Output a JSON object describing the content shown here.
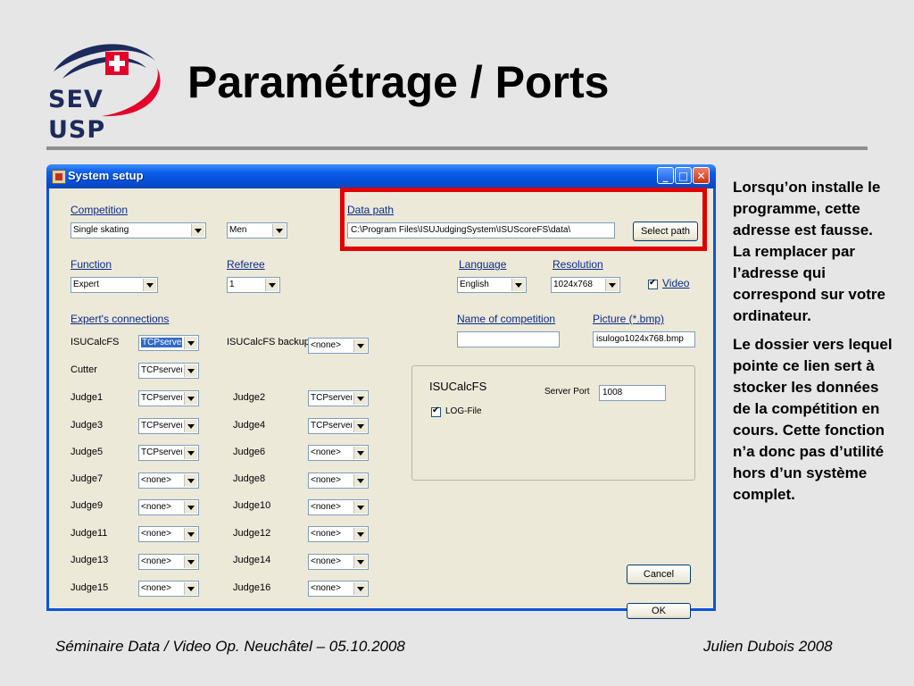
{
  "slide": {
    "logo_top": "SEV",
    "logo_bottom": "USP",
    "title": "Paramétrage / Ports",
    "side_text": [
      "Lorsqu’on installe le programme, cette adresse est fausse. La remplacer par l’adresse qui correspond sur votre ordinateur.",
      "Le dossier vers lequel pointe ce lien sert à stocker les données de la compétition en cours. Cette fonction n’a donc pas d’utilité hors d’un système complet."
    ],
    "footer_left": "Séminaire Data / Video Op. Neuchâtel – 05.10.2008",
    "footer_right": "Julien Dubois 2008",
    "colors": {
      "highlight": "#e00000",
      "logo_red": "#e4002b",
      "logo_blue": "#1d2a5c"
    }
  },
  "window": {
    "title": "System setup",
    "controls": {
      "minimize": "_",
      "maximize": "□",
      "close": "✕"
    }
  },
  "setup": {
    "competition_label": "Competition",
    "competition_value": "Single skating",
    "gender_value": "Men",
    "data_path_label": "Data path",
    "data_path_value": "C:\\Program Files\\ISUJudgingSystem\\ISUScoreFS\\data\\",
    "select_path_button": "Select path",
    "function_label": "Function",
    "function_value": "Expert",
    "referee_label": "Referee",
    "referee_value": "1",
    "language_label": "Language",
    "language_value": "English",
    "resolution_label": "Resolution",
    "resolution_value": "1024x768",
    "video_label": "Video",
    "expert_connections_label": "Expert's connections",
    "name_of_competition_label": "Name of competition",
    "name_of_competition_value": "",
    "picture_label": "Picture (*.bmp)",
    "picture_value": "isulogo1024x768.bmp",
    "connections": {
      "isucalcfs": {
        "label": "ISUCalcFS",
        "value": "TCPserver"
      },
      "isucalcfs_backup": {
        "label": "ISUCalcFS backup",
        "value": "<none>"
      },
      "cutter": {
        "label": "Cutter",
        "value": "TCPserver"
      },
      "judge1": {
        "label": "Judge1",
        "value": "TCPserver"
      },
      "judge2": {
        "label": "Judge2",
        "value": "TCPserver"
      },
      "judge3": {
        "label": "Judge3",
        "value": "TCPserver"
      },
      "judge4": {
        "label": "Judge4",
        "value": "TCPserver"
      },
      "judge5": {
        "label": "Judge5",
        "value": "TCPserver"
      },
      "judge6": {
        "label": "Judge6",
        "value": "<none>"
      },
      "judge7": {
        "label": "Judge7",
        "value": "<none>"
      },
      "judge8": {
        "label": "Judge8",
        "value": "<none>"
      },
      "judge9": {
        "label": "Judge9",
        "value": "<none>"
      },
      "judge10": {
        "label": "Judge10",
        "value": "<none>"
      },
      "judge11": {
        "label": "Judge11",
        "value": "<none>"
      },
      "judge12": {
        "label": "Judge12",
        "value": "<none>"
      },
      "judge13": {
        "label": "Judge13",
        "value": "<none>"
      },
      "judge14": {
        "label": "Judge14",
        "value": "<none>"
      },
      "judge15": {
        "label": "Judge15",
        "value": "<none>"
      },
      "judge16": {
        "label": "Judge16",
        "value": "<none>"
      }
    },
    "isucalcfs_group": {
      "title": "ISUCalcFS",
      "server_port_label": "Server Port",
      "server_port_value": "1008",
      "log_file_label": "LOG-File"
    },
    "cancel_button": "Cancel",
    "ok_button": "OK"
  }
}
